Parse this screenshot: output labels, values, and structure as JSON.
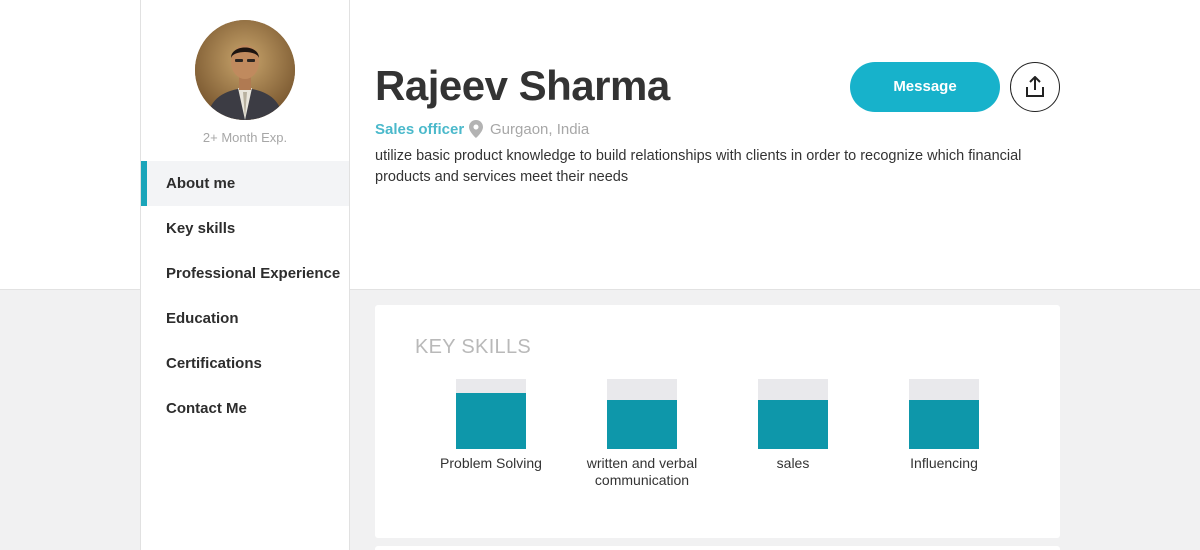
{
  "profile": {
    "name": "Rajeev Sharma",
    "role": "Sales officer",
    "location": "Gurgaon, India",
    "bio": "utilize basic product knowledge to build relationships with clients in order to recognize which financial products and services meet their needs",
    "experience": "2+ Month Exp.",
    "avatar_icon": "user-photo"
  },
  "actions": {
    "message_label": "Message",
    "share_icon": "share-upload-icon"
  },
  "sidebar": {
    "items": [
      {
        "label": "About me",
        "active": true
      },
      {
        "label": "Key skills",
        "active": false
      },
      {
        "label": "Professional Experience",
        "active": false
      },
      {
        "label": "Education",
        "active": false
      },
      {
        "label": "Certifications",
        "active": false
      },
      {
        "label": "Contact Me",
        "active": false
      }
    ]
  },
  "key_skills": {
    "title": "KEY SKILLS",
    "skills": [
      {
        "name": "Problem Solving",
        "level": 0.8
      },
      {
        "name": "written and verbal communication",
        "level": 0.7
      },
      {
        "name": "sales",
        "level": 0.7
      },
      {
        "name": "Influencing",
        "level": 0.7
      }
    ]
  },
  "colors": {
    "accent": "#17b2cb",
    "skill_fill": "#0e97aa",
    "role_text": "#4bb9cb"
  }
}
